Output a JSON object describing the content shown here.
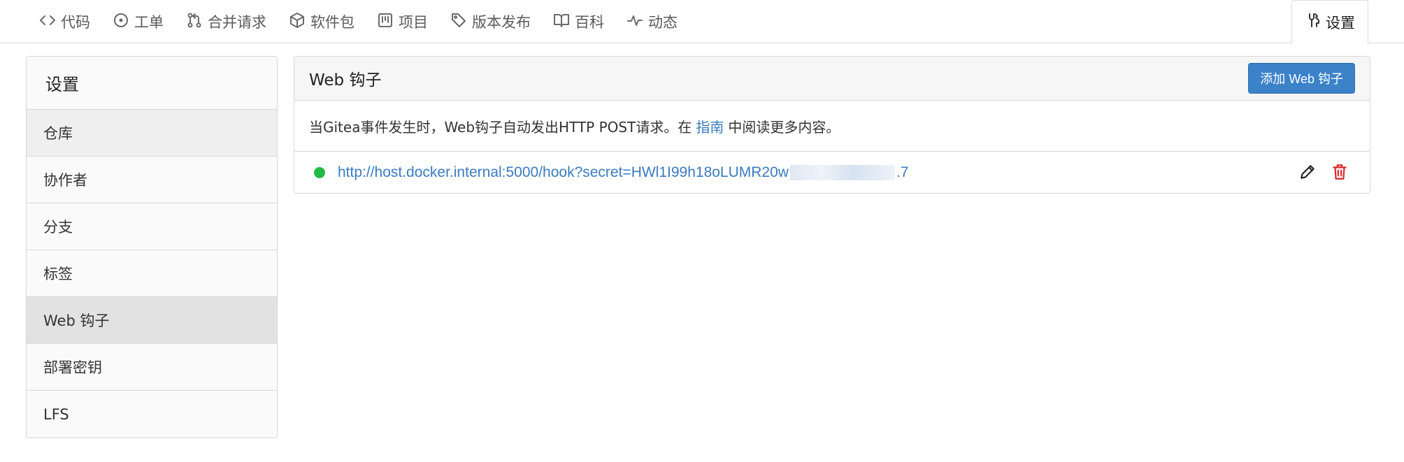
{
  "tabs": [
    {
      "label": "代码",
      "icon": "code-icon"
    },
    {
      "label": "工单",
      "icon": "issue-icon"
    },
    {
      "label": "合并请求",
      "icon": "pull-request-icon"
    },
    {
      "label": "软件包",
      "icon": "package-icon"
    },
    {
      "label": "项目",
      "icon": "project-icon"
    },
    {
      "label": "版本发布",
      "icon": "tag-icon"
    },
    {
      "label": "百科",
      "icon": "book-icon"
    },
    {
      "label": "动态",
      "icon": "pulse-icon"
    }
  ],
  "settings_tab": {
    "label": "设置",
    "icon": "tools-icon"
  },
  "sidebar": {
    "header": "设置",
    "items": [
      {
        "label": "仓库"
      },
      {
        "label": "协作者"
      },
      {
        "label": "分支"
      },
      {
        "label": "标签"
      },
      {
        "label": "Web 钩子"
      },
      {
        "label": "部署密钥"
      },
      {
        "label": "LFS"
      }
    ]
  },
  "panel": {
    "title": "Web 钩子",
    "add_button": "添加 Web 钩子",
    "desc_before": "当Gitea事件发生时，Web钩子自动发出HTTP POST请求。在",
    "desc_link": "指南",
    "desc_after": "中阅读更多内容。"
  },
  "hooks": [
    {
      "url_visible": "http://host.docker.internal:5000/hook?secret=HWl1I99h18oLUMR20w",
      "url_tail": ".7",
      "status": "active"
    }
  ],
  "colors": {
    "accent": "#3b82c9",
    "link": "#3a7bc0",
    "status_ok": "#21ba45",
    "danger": "#db2828"
  }
}
